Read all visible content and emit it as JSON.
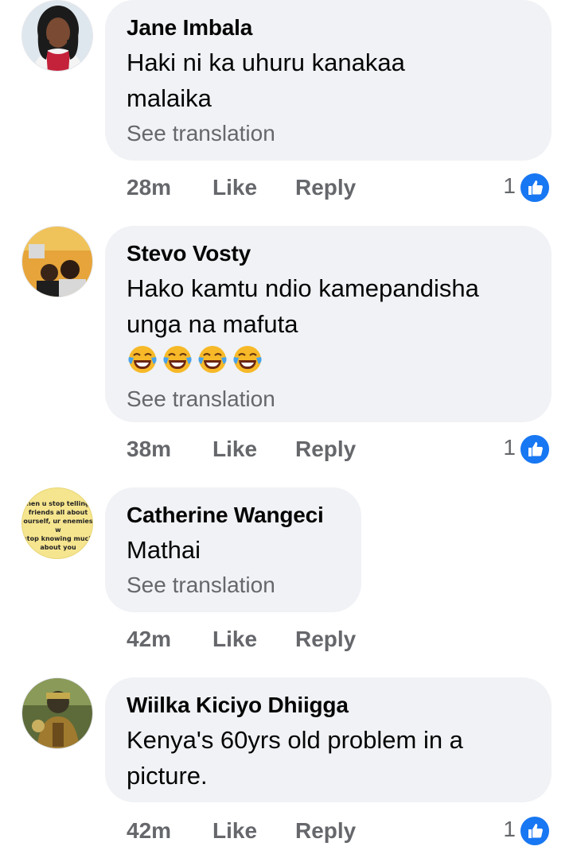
{
  "colors": {
    "bubble": "#f0f2f5",
    "meta": "#65676b",
    "like_blue": "#1877f2"
  },
  "comments": [
    {
      "author": "Jane Imbala",
      "text": "Haki ni ka uhuru kanakaa malaika",
      "see_translation": "See translation",
      "time": "28m",
      "like": "Like",
      "reply": "Reply",
      "reactions": "1",
      "avatar_icon": "profile-photo-woman"
    },
    {
      "author": "Stevo Vosty",
      "text": "Hako kamtu ndio kamepandisha unga na mafuta",
      "emoji_icon": "face-with-tears-of-joy",
      "emoji_count": 4,
      "see_translation": "See translation",
      "time": "38m",
      "like": "Like",
      "reply": "Reply",
      "reactions": "1",
      "avatar_icon": "profile-photo-two-men"
    },
    {
      "author": "Catherine Wangeci",
      "text": "Mathai",
      "see_translation": "See translation",
      "time": "42m",
      "like": "Like",
      "reply": "Reply",
      "avatar_icon": "profile-photo-quote-text",
      "avatar_text": [
        "hen u stop telling",
        "friends all about",
        "ourself, ur enemies w",
        "stop knowing much",
        "about you"
      ]
    },
    {
      "author": "Wiilka Kiciyo Dhiigga",
      "text": "Kenya's 60yrs old problem in a picture.",
      "time": "42m",
      "like": "Like",
      "reply": "Reply",
      "reactions": "1",
      "avatar_icon": "profile-photo-soldier"
    }
  ]
}
